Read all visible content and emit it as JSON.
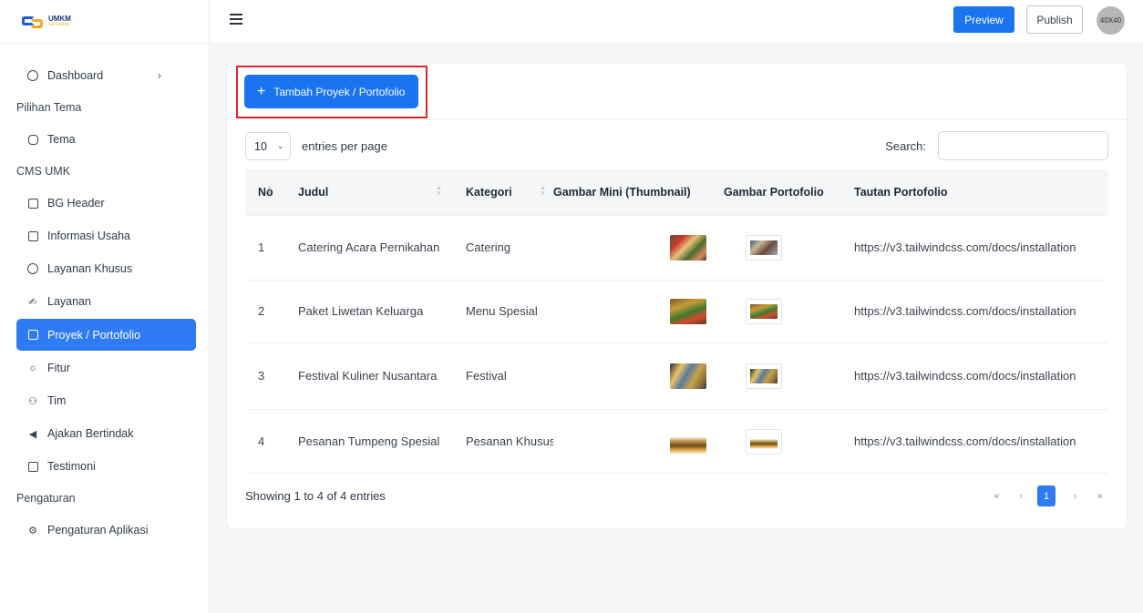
{
  "brand": {
    "logo_title": "UMKM",
    "logo_sub": "Go Online"
  },
  "sidebar": {
    "items": [
      {
        "type": "item",
        "label": "Dashboard",
        "icon": "smiley-icon",
        "chevron": true
      },
      {
        "type": "section",
        "label": "Pilihan Tema"
      },
      {
        "type": "item",
        "label": "Tema",
        "icon": "palette-icon"
      },
      {
        "type": "section",
        "label": "CMS UMK"
      },
      {
        "type": "item",
        "label": "BG Header",
        "icon": "image-icon"
      },
      {
        "type": "item",
        "label": "Informasi Usaha",
        "icon": "info-icon"
      },
      {
        "type": "item",
        "label": "Layanan Khusus",
        "icon": "star-icon"
      },
      {
        "type": "item",
        "label": "Layanan",
        "icon": "handshake-icon"
      },
      {
        "type": "item",
        "label": "Proyek / Portofolio",
        "icon": "briefcase-icon",
        "active": true
      },
      {
        "type": "item",
        "label": "Fitur",
        "icon": "bulb-icon"
      },
      {
        "type": "item",
        "label": "Tim",
        "icon": "team-icon"
      },
      {
        "type": "item",
        "label": "Ajakan Bertindak",
        "icon": "megaphone-icon"
      },
      {
        "type": "item",
        "label": "Testimoni",
        "icon": "chat-icon"
      },
      {
        "type": "section",
        "label": "Pengaturan"
      },
      {
        "type": "item",
        "label": "Pengaturan Aplikasi",
        "icon": "gear-icon"
      }
    ]
  },
  "topbar": {
    "preview_label": "Preview",
    "publish_label": "Publish",
    "avatar_text": "40X40"
  },
  "card": {
    "add_button_label": "Tambah Proyek / Portofolio",
    "entries_value": "10",
    "entries_label": "entries per page",
    "search_label": "Search:",
    "search_value": "",
    "columns": [
      "No",
      "Judul",
      "Kategori",
      "Gambar Mini (Thumbnail)",
      "Gambar Portofolio",
      "Tautan Portofolio"
    ],
    "rows": [
      {
        "no": "1",
        "judul": "Catering Acara Pernikahan",
        "kategori": "Catering",
        "tautan": "https://v3.tailwindcss.com/docs/installation"
      },
      {
        "no": "2",
        "judul": "Paket Liwetan Keluarga",
        "kategori": "Menu Spesial",
        "tautan": "https://v3.tailwindcss.com/docs/installation"
      },
      {
        "no": "3",
        "judul": "Festival Kuliner Nusantara",
        "kategori": "Festival",
        "tautan": "https://v3.tailwindcss.com/docs/installation"
      },
      {
        "no": "4",
        "judul": "Pesanan Tumpeng Spesial",
        "kategori": "Pesanan Khusus",
        "tautan": "https://v3.tailwindcss.com/docs/installation"
      }
    ],
    "footer_info": "Showing 1 to 4 of 4 entries",
    "pager": {
      "first": "«",
      "prev": "‹",
      "current": "1",
      "next": "›",
      "last": "»"
    }
  },
  "colors": {
    "primary": "#1a73ef",
    "active_menu": "#2f7bf3",
    "highlight_border": "#e0262d"
  }
}
